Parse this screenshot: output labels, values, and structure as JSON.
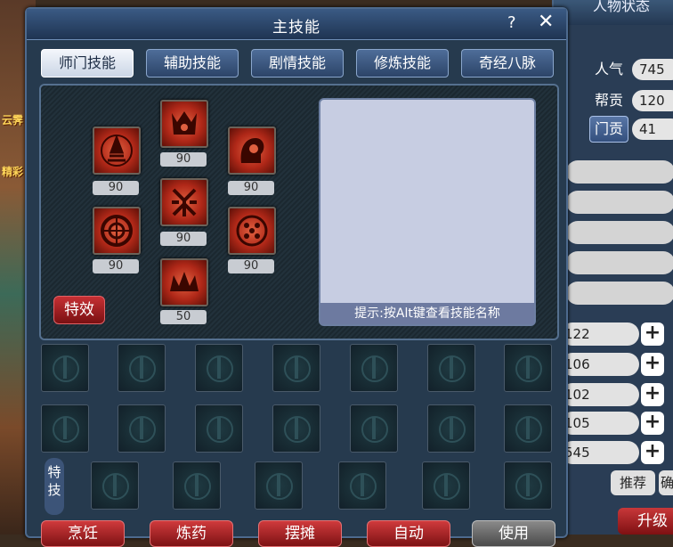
{
  "background": {
    "left_labels": [
      "云霁",
      "精彩"
    ]
  },
  "status_panel": {
    "title": "人物状态",
    "stats": [
      {
        "label": "人气",
        "value": "745"
      },
      {
        "label": "帮贡",
        "value": "120"
      },
      {
        "label": "门贡",
        "value": "41"
      }
    ],
    "attributes": [
      "122",
      "106",
      "102",
      "105",
      "545"
    ],
    "plus_symbol": "+",
    "recommend_label": "推荐",
    "confirm_label": "确",
    "upgrade_label": "升级"
  },
  "dialog": {
    "title": "主技能",
    "help": "?",
    "close": "✕",
    "tabs": [
      "师门技能",
      "辅助技能",
      "剧情技能",
      "修炼技能",
      "奇经八脉"
    ],
    "active_tab": 0,
    "skills": [
      {
        "icon": "pagoda-icon",
        "level": "90"
      },
      {
        "icon": "crown-icon",
        "level": "90"
      },
      {
        "icon": "head-icon",
        "level": "90"
      },
      {
        "icon": "rune-icon",
        "level": "90"
      },
      {
        "icon": "wheel-icon",
        "level": "90"
      },
      {
        "icon": "dots-icon",
        "level": "90"
      },
      {
        "icon": "spikes-icon",
        "level": "50"
      }
    ],
    "effect_button": "特效",
    "hint": "提示:按Alt键查看技能名称",
    "special_label": "特技",
    "bottom_buttons": [
      "烹饪",
      "炼药",
      "摆摊",
      "自动",
      "使用"
    ]
  },
  "colors": {
    "accent_red": "#c63034",
    "panel_blue": "#263a4e",
    "tab_active": "#f3f6fb"
  }
}
